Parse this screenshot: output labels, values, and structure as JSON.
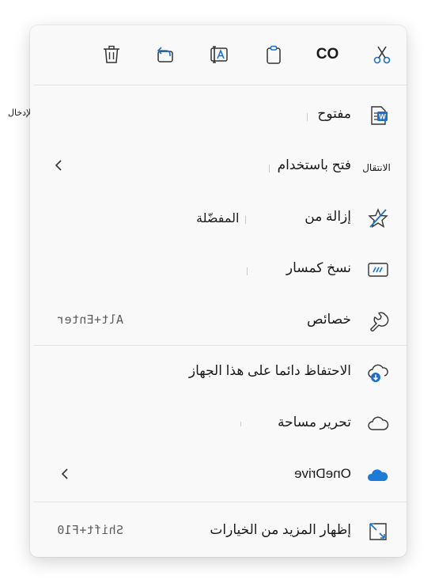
{
  "toolbar": {
    "copy_text": "CO"
  },
  "outside_label": "مفتاح الإدخال \"Enter\"",
  "items": [
    {
      "label": "مفتوح"
    },
    {
      "label": "فتح باستخدام",
      "icon_tag": "الانتقال"
    },
    {
      "label": "إزالة من",
      "extra": "المفضّلة"
    },
    {
      "label": "نسخ كمسار"
    },
    {
      "label": "خصائص",
      "shortcut": "Alt+Enter"
    },
    {
      "label": "الاحتفاظ دائما على هذا الجهاز"
    },
    {
      "label": "تحرير مساحة"
    },
    {
      "label": "OneDrive",
      "mirrored": true
    },
    {
      "label": "إظهار المزيد من الخيارات",
      "shortcut": "Shift+F10"
    }
  ],
  "colors": {
    "accent": "#1f6fc8",
    "onedrive": "#1c7bd6",
    "menu_bg": "#f9f9f9",
    "separator": "#e3e3e3"
  }
}
